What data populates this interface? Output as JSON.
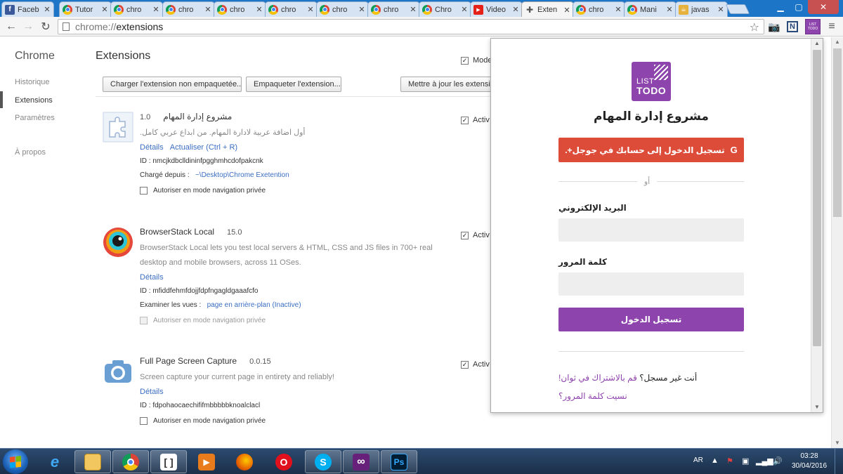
{
  "tabs": [
    {
      "title": "Faceb",
      "icon": "facebook-icon"
    },
    {
      "title": "Tutor",
      "icon": "chrome-icon"
    },
    {
      "title": "chro",
      "icon": "chrome-icon"
    },
    {
      "title": "chro",
      "icon": "chrome-icon"
    },
    {
      "title": "chro",
      "icon": "chrome-icon"
    },
    {
      "title": "chro",
      "icon": "chrome-icon"
    },
    {
      "title": "chro",
      "icon": "chrome-icon"
    },
    {
      "title": "chro",
      "icon": "chrome-icon"
    },
    {
      "title": "Chro",
      "icon": "chrome-icon"
    },
    {
      "title": "Video",
      "icon": "video-icon"
    },
    {
      "title": "Exten",
      "icon": "puzzle-icon",
      "active": true
    },
    {
      "title": "chro",
      "icon": "chrome-icon"
    },
    {
      "title": "Mani",
      "icon": "chrome-icon"
    },
    {
      "title": "javas",
      "icon": "java-icon"
    }
  ],
  "tab_close": "✕",
  "address": {
    "scheme": "chrome://",
    "path": "extensions"
  },
  "sidebar": {
    "title": "Chrome",
    "items": [
      "Historique",
      "Extensions",
      "Paramètres",
      "À propos"
    ]
  },
  "main": {
    "title": "Extensions",
    "devmode_label": "Mode",
    "buttons": [
      "Charger l'extension non empaquetée...",
      "Empaqueter l'extension...",
      "Mettre à jour les extensions"
    ]
  },
  "extensions": [
    {
      "name": "مشروع إدارة المهام",
      "version": "1.0",
      "description": "أول اضافة عربية لادارة المهام. من ابداع عربي كامل.",
      "links": [
        "Détails",
        "Actualiser (Ctrl + R)"
      ],
      "id": "ID : nmcjkdbclldininfpgghmhcdofpakcnk",
      "meta_label": "Chargé depuis :",
      "meta_value": "~\\Desktop\\Chrome Exetention",
      "private": "Autoriser en mode navigation privée",
      "enabled": "Activ"
    },
    {
      "name": "BrowserStack Local",
      "version": "15.0",
      "description": "BrowserStack Local lets you test local servers & HTML, CSS and JS files in 700+ real desktop and mobile browsers, across 11 OSes.",
      "links": [
        "Détails"
      ],
      "id": "ID : mfiddfehmfdojjfdpfngagldgaaafcfo",
      "meta_label": "Examiner les vues :",
      "meta_value": "page en arrière-plan (Inactive)",
      "private": "Autoriser en mode navigation privée",
      "enabled": "Activ"
    },
    {
      "name": "Full Page Screen Capture",
      "version": "0.0.15",
      "description": "Screen capture your current page in entirety and reliably!",
      "links": [
        "Détails"
      ],
      "id": "ID : fdpohaocaechififmbbbbbknoalclacl",
      "private": "Autoriser en mode navigation privée",
      "enabled": "Activ"
    }
  ],
  "popup": {
    "logo_line1": "LIST",
    "logo_line2": "TODO",
    "title": "مشروع إدارة المهام",
    "google_button": "تسجيل الدخول إلى حسابك في جوجل+.",
    "google_glyph": "G",
    "or": "أو",
    "email_label": "البريد الإلكتروني",
    "email_value": "",
    "password_label": "كلمة المرور",
    "password_value": "",
    "login_button": "تسجيل الدخول",
    "not_registered": "أنت غير مسجل؟",
    "register_link": "قم بالاشتراك في ثوان!",
    "forgot_link": "نسيت كلمة المرور؟"
  },
  "taskbar": {
    "lang": "AR",
    "time": "03:28",
    "date": "30/04/2016"
  },
  "colors": {
    "purple": "#8e44ad",
    "google_red": "#dd4b39",
    "link_blue": "#3b6ec2"
  }
}
